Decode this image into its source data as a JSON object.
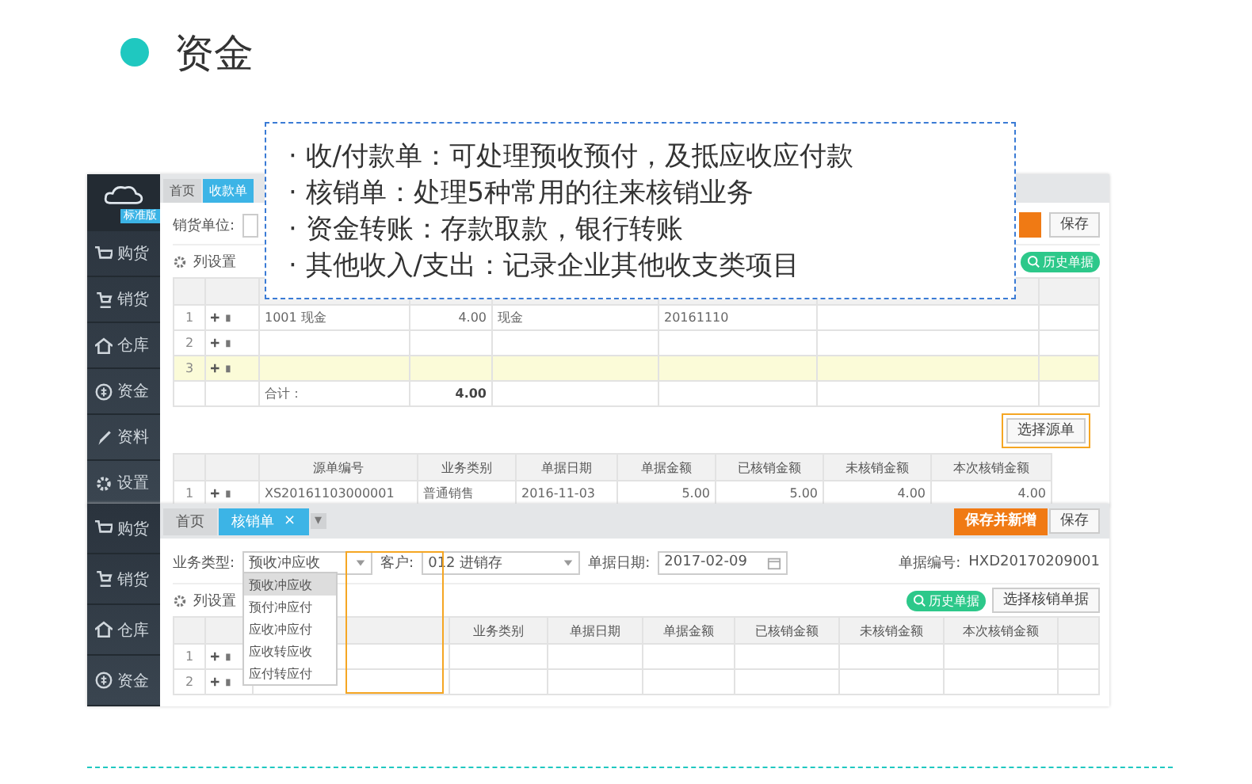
{
  "slide": {
    "title": "资金"
  },
  "callout": {
    "lines": [
      "· 收/付款单：可处理预收预付，及抵应收应付款",
      "· 核销单：处理5种常用的往来核销业务",
      "· 资金转账：存款取款，银行转账",
      "· 其他收入/支出：记录企业其他收支类项目"
    ]
  },
  "receipt_window": {
    "sidebar": {
      "badge": "标准版",
      "items": [
        {
          "label": "购货",
          "kind": "cart"
        },
        {
          "label": "销货",
          "kind": "sale"
        },
        {
          "label": "仓库",
          "kind": "house"
        },
        {
          "label": "资金",
          "kind": "money"
        },
        {
          "label": "资料",
          "kind": "pen"
        },
        {
          "label": "设置",
          "kind": "gear"
        }
      ]
    },
    "tabs": [
      {
        "label": "首页",
        "selected": false
      },
      {
        "label": "收款单",
        "selected": true
      }
    ],
    "form_label": "销货单位:",
    "save_button": "保存",
    "column_settings": "列设置",
    "history_button": "历史单据",
    "entries": [
      {
        "no": "1",
        "cells": [
          "1001 现金",
          "4.00",
          "现金",
          "20161110"
        ],
        "highlighted": false
      },
      {
        "no": "2",
        "highlighted": false
      },
      {
        "no": "3",
        "highlighted": true
      }
    ],
    "total_label": "合计：",
    "total": "4.00",
    "select_source_button": "选择源单",
    "source_table": {
      "columns": [
        "源单编号",
        "业务类别",
        "单据日期",
        "单据金额",
        "已核销金额",
        "未核销金额",
        "本次核销金额"
      ],
      "rows": [
        {
          "no": "1",
          "cells": [
            "XS20161103000001",
            "普通销售",
            "2016-11-03",
            "5.00",
            "5.00",
            "4.00",
            "4.00"
          ]
        }
      ]
    }
  },
  "writeoff_window": {
    "sidebar": {
      "items": [
        {
          "label": "购货",
          "kind": "cart"
        },
        {
          "label": "销货",
          "kind": "sale"
        },
        {
          "label": "仓库",
          "kind": "house"
        },
        {
          "label": "资金",
          "kind": "money"
        }
      ]
    },
    "tabs": [
      {
        "label": "首页",
        "selected": false
      },
      {
        "label": "核销单",
        "selected": true,
        "close": "×"
      }
    ],
    "tab_menu": "▾",
    "buttons": {
      "save_new": "保存并新增",
      "save": "保存"
    },
    "type_field": {
      "label": "业务类型:",
      "value": "预收冲应收",
      "options": [
        {
          "label": "预收冲应收",
          "selected": true
        },
        {
          "label": "预付冲应付",
          "selected": false
        },
        {
          "label": "应收冲应付",
          "selected": false
        },
        {
          "label": "应收转应收",
          "selected": false
        },
        {
          "label": "应付转应付",
          "selected": false
        }
      ]
    },
    "customer_field": {
      "label": "客户:",
      "value": "012 进销存"
    },
    "date_field": {
      "label": "单据日期:",
      "value": "2017-02-09"
    },
    "number_field": {
      "label": "单据编号:",
      "value": "HXD20170209001"
    },
    "column_settings": "列设置",
    "history_button": "历史单据",
    "select_button": "选择核销单据",
    "columns": [
      "业务类别",
      "单据日期",
      "单据金额",
      "已核销金额",
      "未核销金额",
      "本次核销金额"
    ],
    "rows": [
      {
        "no": "1"
      },
      {
        "no": "2"
      }
    ]
  }
}
